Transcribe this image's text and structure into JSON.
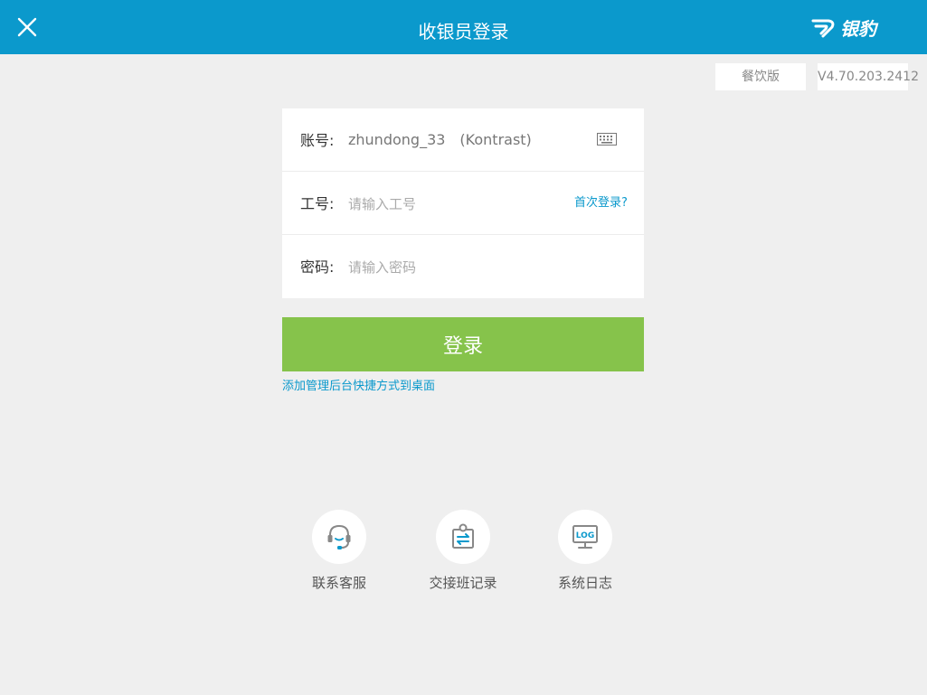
{
  "header": {
    "title": "收银员登录",
    "brand": "银豹"
  },
  "edition": "餐饮版",
  "version": "V4.70.203.2412",
  "form": {
    "account_label": "账号:",
    "account_value": "zhundong_33　(Kontrast)",
    "employee_label": "工号:",
    "employee_placeholder": "请输入工号",
    "first_login": "首次登录?",
    "password_label": "密码:",
    "password_placeholder": "请输入密码"
  },
  "login_button": "登录",
  "shortcut_link": "添加管理后台快捷方式到桌面",
  "tools": [
    {
      "label": "联系客服",
      "icon": "headset-icon"
    },
    {
      "label": "交接班记录",
      "icon": "shift-record-icon"
    },
    {
      "label": "系统日志",
      "icon": "log-monitor-icon"
    }
  ],
  "log_icon_text": "LOG",
  "colors": {
    "header": "#0b99cc",
    "login_button": "#86c34b",
    "link": "#0b99cc",
    "background": "#efefef"
  }
}
